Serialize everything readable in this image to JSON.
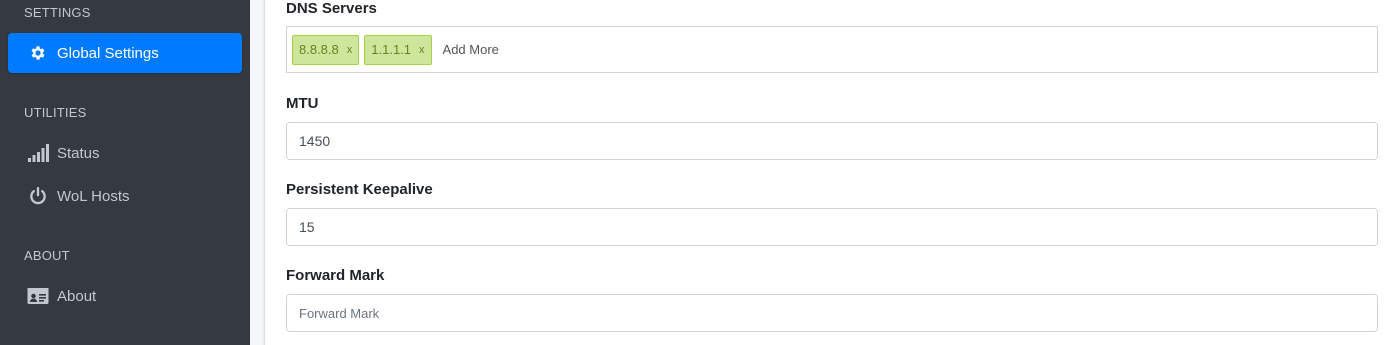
{
  "sidebar": {
    "sections": [
      {
        "header": "SETTINGS"
      },
      {
        "header": "UTILITIES"
      },
      {
        "header": "ABOUT"
      }
    ],
    "items": [
      {
        "label": "Global Settings",
        "icon": "gear-icon",
        "active": true
      },
      {
        "label": "Status",
        "icon": "signal-icon",
        "active": false
      },
      {
        "label": "WoL Hosts",
        "icon": "power-icon",
        "active": false
      },
      {
        "label": "About",
        "icon": "id-card-icon",
        "active": false
      }
    ]
  },
  "form": {
    "dns": {
      "label": "DNS Servers",
      "tags": [
        {
          "value": "8.8.8.8",
          "remove": "x"
        },
        {
          "value": "1.1.1.1",
          "remove": "x"
        }
      ],
      "add_more": "Add More"
    },
    "mtu": {
      "label": "MTU",
      "value": "1450"
    },
    "keepalive": {
      "label": "Persistent Keepalive",
      "value": "15"
    },
    "forward_mark": {
      "label": "Forward Mark",
      "placeholder": "Forward Mark"
    }
  },
  "colors": {
    "sidebar_bg": "#343a40",
    "active_item": "#007bff",
    "tag_bg": "#cde69c",
    "tag_border": "#a5d24a",
    "tag_text": "#638421"
  }
}
